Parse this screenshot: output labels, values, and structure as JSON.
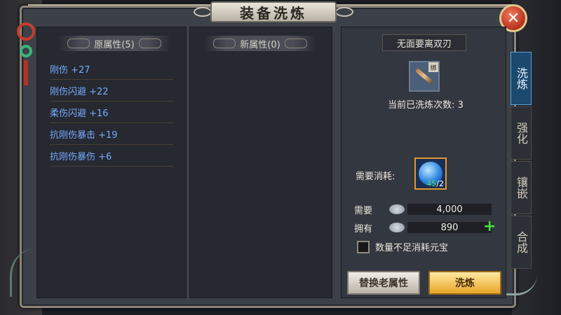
{
  "window": {
    "title": "装备洗炼",
    "close_icon": "close-icon"
  },
  "original_attributes": {
    "header": "原属性(5)",
    "items": [
      {
        "label": "刚伤 +27"
      },
      {
        "label": "刚伤闪避 +22"
      },
      {
        "label": "柔伤闪避 +16"
      },
      {
        "label": "抗刚伤暴击 +19"
      },
      {
        "label": "抗刚伤暴伤 +6"
      }
    ]
  },
  "new_attributes": {
    "header": "新属性(0)"
  },
  "equipment": {
    "name": "无面要离双刃",
    "icon": "dual-blade-icon",
    "bind_tag": "绑",
    "refine_count_text": "当前已洗炼次数: 3"
  },
  "cost": {
    "label": "需要消耗:",
    "icon": "refine-stone-icon",
    "have_qty": "45",
    "need_qty": "/2"
  },
  "silver": {
    "need_label": "需要",
    "need_value": "4,000",
    "have_label": "拥有",
    "have_value": "890",
    "add_icon": "plus-icon"
  },
  "option": {
    "label": "数量不足消耗元宝",
    "checked": false
  },
  "buttons": {
    "replace": "替换老属性",
    "refine": "洗炼"
  },
  "side_tabs": [
    {
      "label": "洗炼",
      "active": true
    },
    {
      "label": "强化",
      "active": false
    },
    {
      "label": "镶嵌",
      "active": false
    },
    {
      "label": "合成",
      "active": false
    }
  ],
  "colors": {
    "attribute_text": "#76a9ff",
    "refine_button": "#e7a628",
    "plus": "#48e03a",
    "active_tab": "#1b4a6e"
  }
}
